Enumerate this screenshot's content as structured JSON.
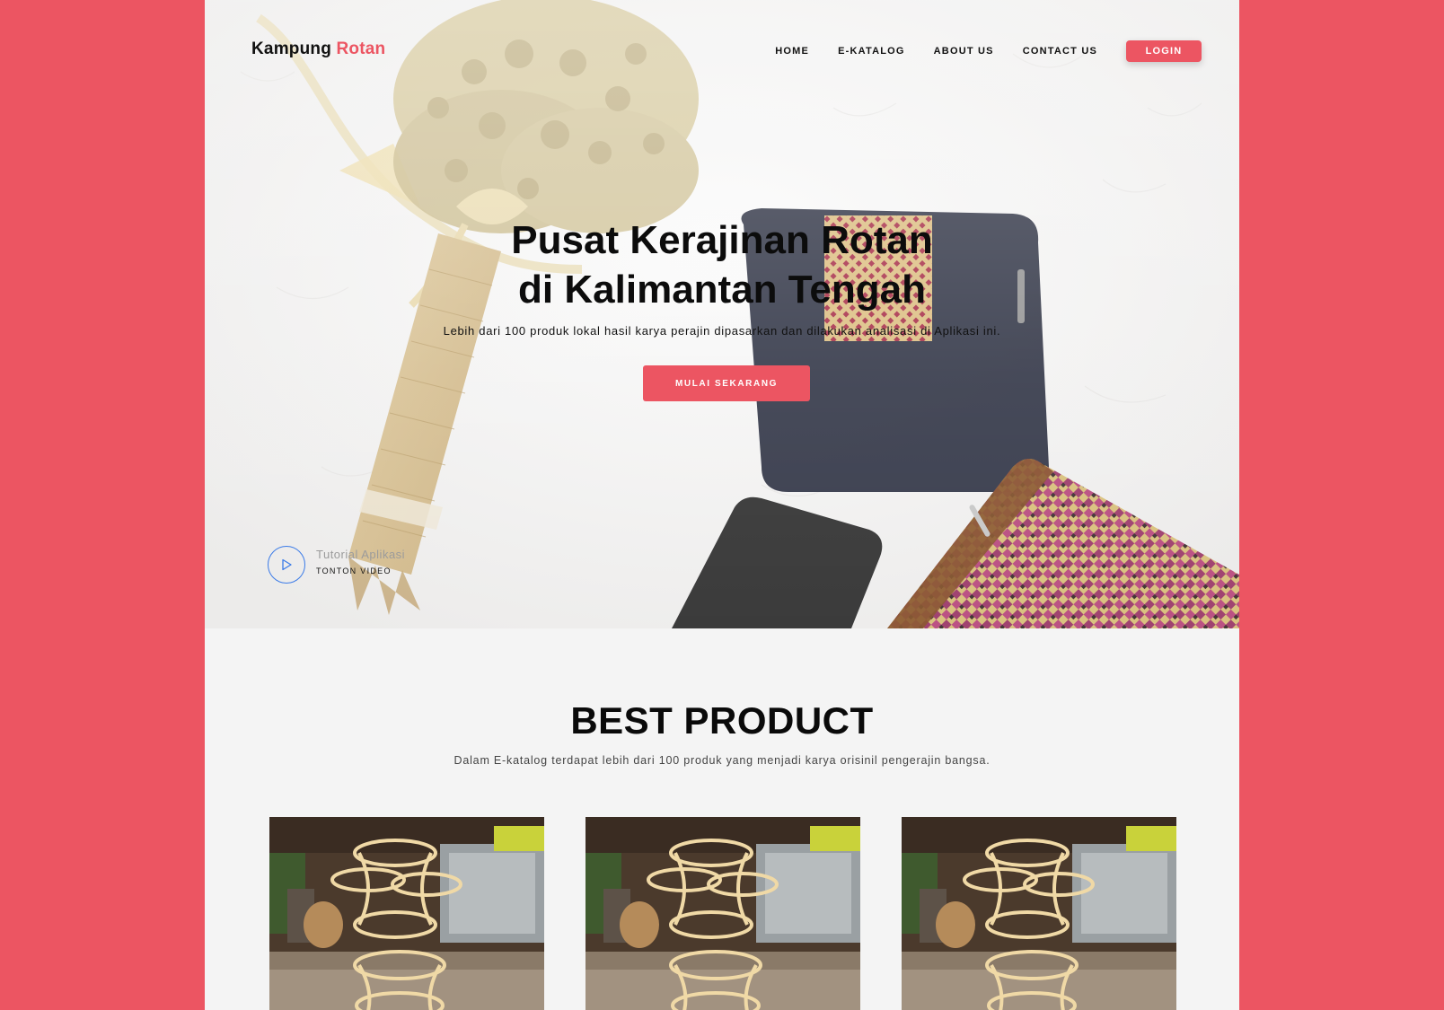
{
  "brand": {
    "name": "Kampung",
    "accent": "Rotan",
    "accent_color": "#ec5562"
  },
  "nav": {
    "items": [
      "HOME",
      "E-KATALOG",
      "ABOUT US",
      "CONTACT US"
    ],
    "login_label": "LOGIN"
  },
  "hero": {
    "title_line1": "Pusat Kerajinan Rotan",
    "title_line2": "di Kalimantan Tengah",
    "subtitle": "Lebih dari 100 produk lokal hasil karya perajin dipasarkan dan dilakukan analisasi di Aplikasi ini.",
    "cta_label": "MULAI SEKARANG",
    "video_title": "Tutorial Aplikasi",
    "video_link": "TONTON VIDEO",
    "play_icon": "play-icon"
  },
  "products": {
    "title": "BEST PRODUCT",
    "subtitle": "Dalam E-katalog terdapat lebih dari 100 produk yang menjadi karya orisinil pengerajin bangsa.",
    "cards": [
      {
        "image": "rattan-stools-photo"
      },
      {
        "image": "rattan-stools-photo"
      },
      {
        "image": "rattan-stools-photo"
      }
    ]
  },
  "colors": {
    "background": "#ec5562",
    "page": "#f4f4f4",
    "play_ring": "#3b7be8"
  }
}
